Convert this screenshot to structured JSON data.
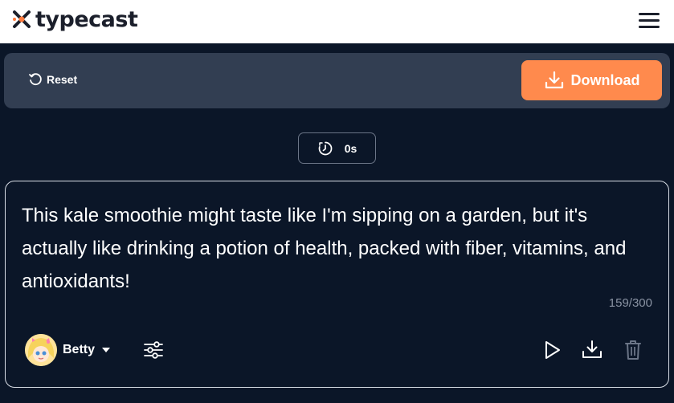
{
  "header": {
    "logo_text": "typecast",
    "logo_icon": "typecast-logo-icon",
    "menu_icon": "hamburger-menu-icon"
  },
  "toolbar": {
    "reset_label": "Reset",
    "reset_icon": "reset-icon",
    "download_label": "Download",
    "download_icon": "download-icon",
    "download_color": "#ff8a4d"
  },
  "duration": {
    "value": "0s",
    "icon": "timer-icon"
  },
  "editor": {
    "text": "This kale smoothie might taste like I'm sipping on a garden, but it's actually like drinking a potion of health, packed with fiber, vitamins, and antioxidants!",
    "char_count": "159/300",
    "voice": {
      "name": "Betty",
      "avatar_icon": "voice-avatar"
    },
    "actions": {
      "settings_icon": "sliders-icon",
      "play_icon": "play-icon",
      "download_icon": "download-icon",
      "delete_icon": "trash-icon"
    }
  },
  "colors": {
    "background": "#0b1628",
    "toolbar": "#323e52",
    "accent": "#ff8a4d"
  }
}
